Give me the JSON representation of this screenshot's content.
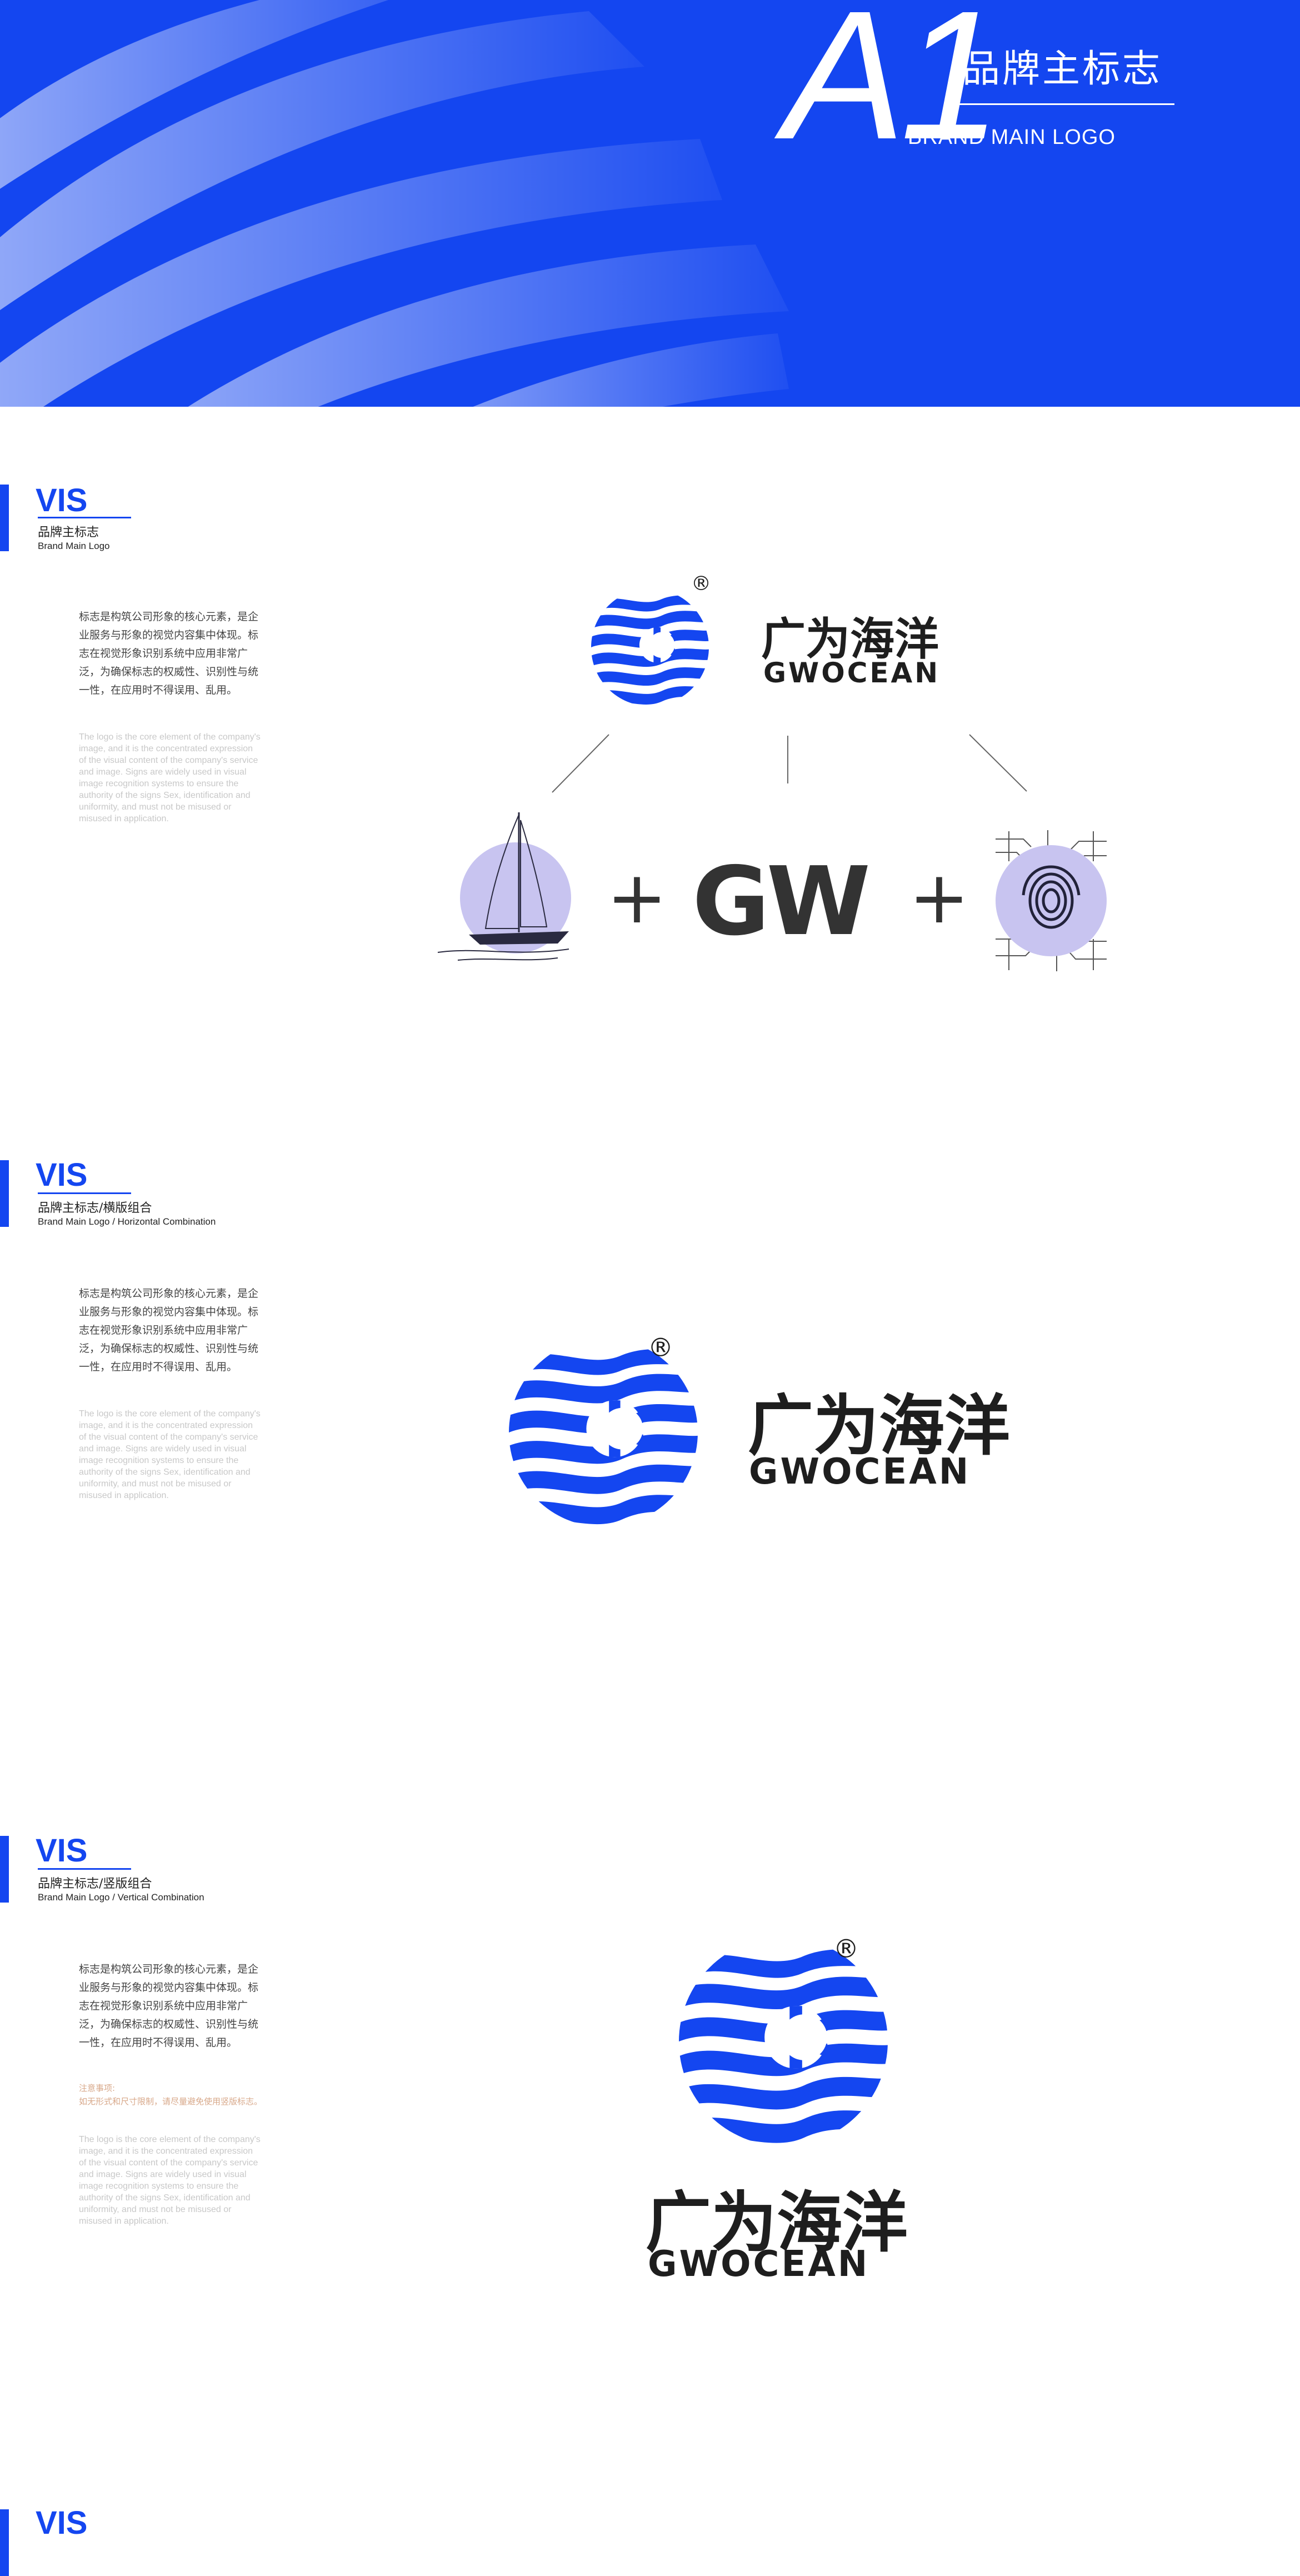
{
  "colors": {
    "brand_blue": "#1446f0",
    "dark": "#1e1e1e",
    "lavender": "#c8c4f0"
  },
  "banner": {
    "code": "A1",
    "title_cn": "品牌主标志",
    "title_en": "BRAND MAIN LOGO"
  },
  "logo": {
    "name_cn": "广为海洋",
    "name_en": "GWOCEAN",
    "registered": "®"
  },
  "sections": [
    {
      "tag": "VIS",
      "title_cn": "品牌主标志",
      "title_en": "Brand Main Logo",
      "desc_cn": "标志是构筑公司形象的核心元素，是企业服务与形象的视觉内容集中体现。标志在视觉形象识别系统中应用非常广泛，为确保标志的权威性、识别性与统一性，在应用时不得误用、乱用。",
      "desc_en": "The logo is the core element of the company's image, and it is the concentrated expression of the visual content of the company's service and image. Signs are widely used in visual image recognition systems to ensure the authority of the signs Sex, identification and uniformity, and must not be misused or misused in application.",
      "composition": {
        "plus": "+",
        "letters": "GW"
      }
    },
    {
      "tag": "VIS",
      "title_cn": "品牌主标志/横版组合",
      "title_en": "Brand Main Logo / Horizontal Combination",
      "desc_cn": "标志是构筑公司形象的核心元素，是企业服务与形象的视觉内容集中体现。标志在视觉形象识别系统中应用非常广泛，为确保标志的权威性、识别性与统一性，在应用时不得误用、乱用。",
      "desc_en": "The logo is the core element of the company's image, and it is the concentrated expression of the visual content of the company's service and image. Signs are widely used in visual image recognition systems to ensure the authority of the signs Sex, identification and uniformity, and must not be misused or misused in application."
    },
    {
      "tag": "VIS",
      "title_cn": "品牌主标志/竖版组合",
      "title_en": "Brand Main Logo / Vertical Combination",
      "desc_cn": "标志是构筑公司形象的核心元素，是企业服务与形象的视觉内容集中体现。标志在视觉形象识别系统中应用非常广泛，为确保标志的权威性、识别性与统一性，在应用时不得误用、乱用。",
      "note_title": "注意事项:",
      "note_body": "如无形式和尺寸限制，请尽量避免使用竖版标志。",
      "desc_en": "The logo is the core element of the company's image, and it is the concentrated expression of the visual content of the company's service and image. Signs are widely used in visual image recognition systems to ensure the authority of the signs Sex, identification and uniformity, and must not be misused or misused in application."
    },
    {
      "tag": "VIS"
    }
  ]
}
